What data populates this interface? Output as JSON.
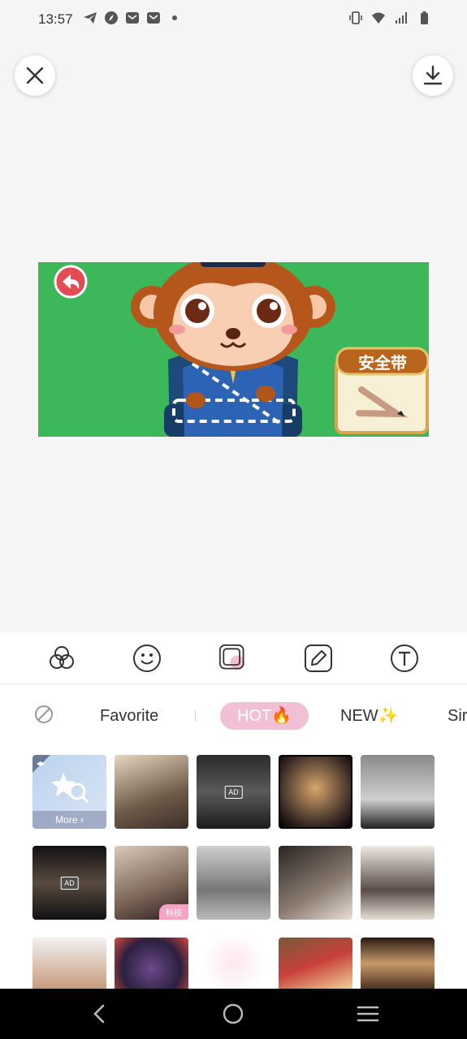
{
  "status_bar": {
    "time": "13:57",
    "left_icons": [
      "telegram-icon",
      "compass-icon",
      "mail-icon",
      "mail-icon",
      "dot-icon"
    ],
    "right_icons": [
      "vibrate-icon",
      "wifi-icon",
      "signal-icon",
      "battery-icon"
    ]
  },
  "top_actions": {
    "close_icon": "close-icon",
    "download_icon": "download-icon"
  },
  "preview": {
    "background_color": "#3cb85a",
    "sign_text": "安全带"
  },
  "toolbar": {
    "tools": [
      "filter-icon",
      "sticker-icon",
      "frame-icon",
      "edit-icon",
      "text-icon"
    ],
    "active_tool": "frame-icon"
  },
  "categories": {
    "none_icon": "no-effect-icon",
    "items": [
      "Favorite",
      "HOT🔥",
      "NEW✨",
      "Sir"
    ],
    "active": "HOT🔥"
  },
  "grid": {
    "more_label": "More",
    "ad_label": "AD",
    "tag_label": "科技"
  },
  "navbar": {
    "icons": [
      "back-icon",
      "home-icon",
      "menu-icon"
    ]
  }
}
